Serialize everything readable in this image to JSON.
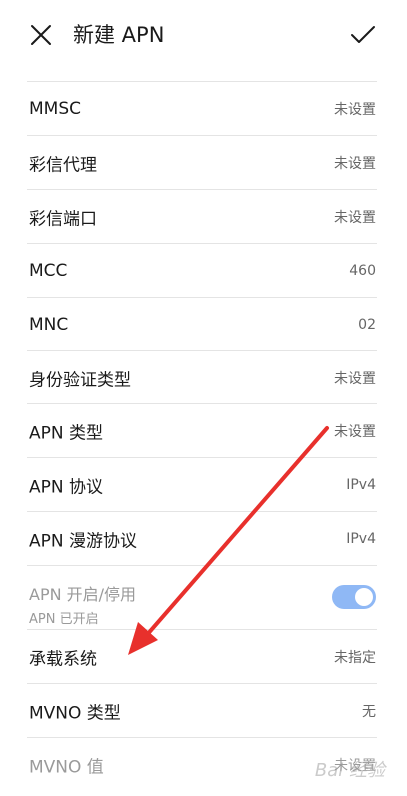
{
  "header": {
    "title": "新建 APN",
    "close_icon": "close-icon",
    "confirm_icon": "checkmark-icon"
  },
  "rows": [
    {
      "label": "MMSC",
      "value": "未设置"
    },
    {
      "label": "彩信代理",
      "value": "未设置"
    },
    {
      "label": "彩信端口",
      "value": "未设置"
    },
    {
      "label": "MCC",
      "value": "460"
    },
    {
      "label": "MNC",
      "value": "02"
    },
    {
      "label": "身份验证类型",
      "value": "未设置"
    },
    {
      "label": "APN 类型",
      "value": "未设置"
    },
    {
      "label": "APN 协议",
      "value": "IPv4"
    },
    {
      "label": "APN 漫游协议",
      "value": "IPv4"
    }
  ],
  "apn_toggle": {
    "label": "APN 开启/停用",
    "sublabel": "APN 已开启",
    "checked": true
  },
  "rows_after": [
    {
      "label": "承载系统",
      "value": "未指定"
    },
    {
      "label": "MVNO 类型",
      "value": "无"
    },
    {
      "label": "MVNO 值",
      "value": "未设置"
    }
  ],
  "colors": {
    "toggle_on": "#8fb8f5",
    "arrow": "#e8302c",
    "divider": "#e4e4e4"
  },
  "annotation": {
    "arrow_icon": "red-arrow-annotation"
  },
  "watermark": {
    "text": "Bai  经验"
  }
}
